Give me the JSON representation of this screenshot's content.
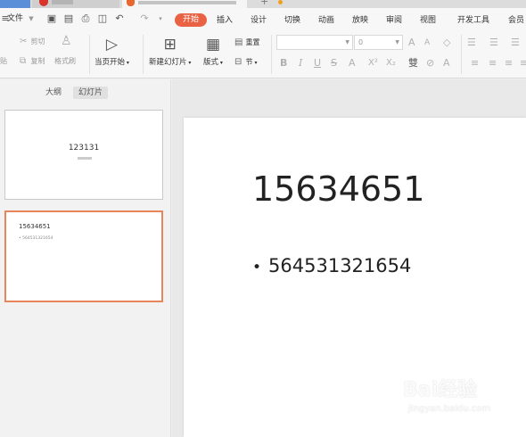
{
  "titlebar": {
    "tab1_label": "",
    "tab2_label": "",
    "tab3_label": ""
  },
  "menu": {
    "file_label": "文件",
    "tabs": [
      "开始",
      "插入",
      "设计",
      "切换",
      "动画",
      "放映",
      "审阅",
      "视图",
      "开发工具",
      "会员"
    ]
  },
  "toolbar": {
    "cut_label": "剪切",
    "copy_label": "复制",
    "format_painter_label": "格式刷",
    "paste_label": "贴",
    "from_current_label": "当页开始",
    "new_slide_label": "新建幻灯片",
    "layout_label": "版式",
    "reset_label": "重置",
    "section_label": "节",
    "font_size_value": "0"
  },
  "panel": {
    "tabs": [
      "大纲",
      "幻灯片"
    ]
  },
  "thumbnails": [
    {
      "title": "123131"
    },
    {
      "title": "15634651",
      "bullet": "• 564531321654"
    }
  ],
  "slide": {
    "title": "15634651",
    "bullet": "564531321654"
  },
  "watermark": {
    "brand": "Bai经验",
    "url": "jingyan.baidu.com"
  },
  "colors": {
    "accent": "#ea6244",
    "selection": "#e8855a"
  }
}
